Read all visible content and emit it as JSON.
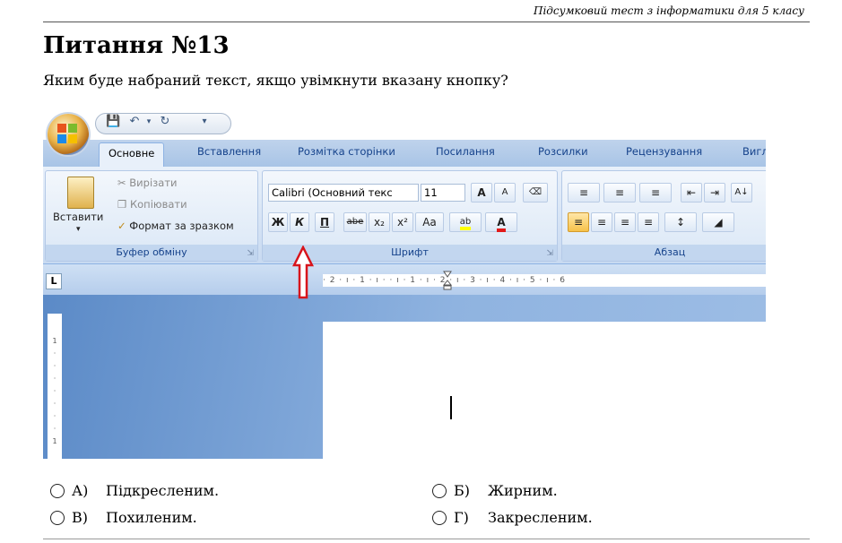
{
  "header": {
    "subtitle": "Підсумковий тест з інформатики для 5 класу"
  },
  "question": {
    "title": "Питання №13",
    "text": "Яким буде набраний текст, якщо увімкнути вказану кнопку?"
  },
  "word": {
    "tabs": [
      "Основне",
      "Вставлення",
      "Розмітка сторінки",
      "Посилання",
      "Розсилки",
      "Рецензування",
      "Вигл"
    ],
    "clipboard": {
      "paste": "Вставити",
      "cut": "Вирізати",
      "copy": "Копіювати",
      "format_painter": "Формат за зразком",
      "label": "Буфер обміну"
    },
    "font": {
      "name": "Calibri (Основний текс",
      "size": "11",
      "bold": "Ж",
      "italic": "К",
      "underline": "П",
      "strike": "abe",
      "subscript": "x₂",
      "superscript": "x²",
      "case": "Aa",
      "grow": "A",
      "shrink": "A",
      "label": "Шрифт"
    },
    "paragraph": {
      "label": "Абзац"
    },
    "ruler_text": "· 2 · ı · 1 · ı ·   · ı · 1 · ı · 2 · ı · 3 · ı · 4 · ı · 5 · ı · 6",
    "tab_selector": "L",
    "accent": "#2b579a"
  },
  "answers": [
    {
      "letter": "А)",
      "text": "Підкресленим."
    },
    {
      "letter": "Б)",
      "text": "Жирним."
    },
    {
      "letter": "В)",
      "text": "Похиленим."
    },
    {
      "letter": "Г)",
      "text": "Закресленим."
    }
  ]
}
